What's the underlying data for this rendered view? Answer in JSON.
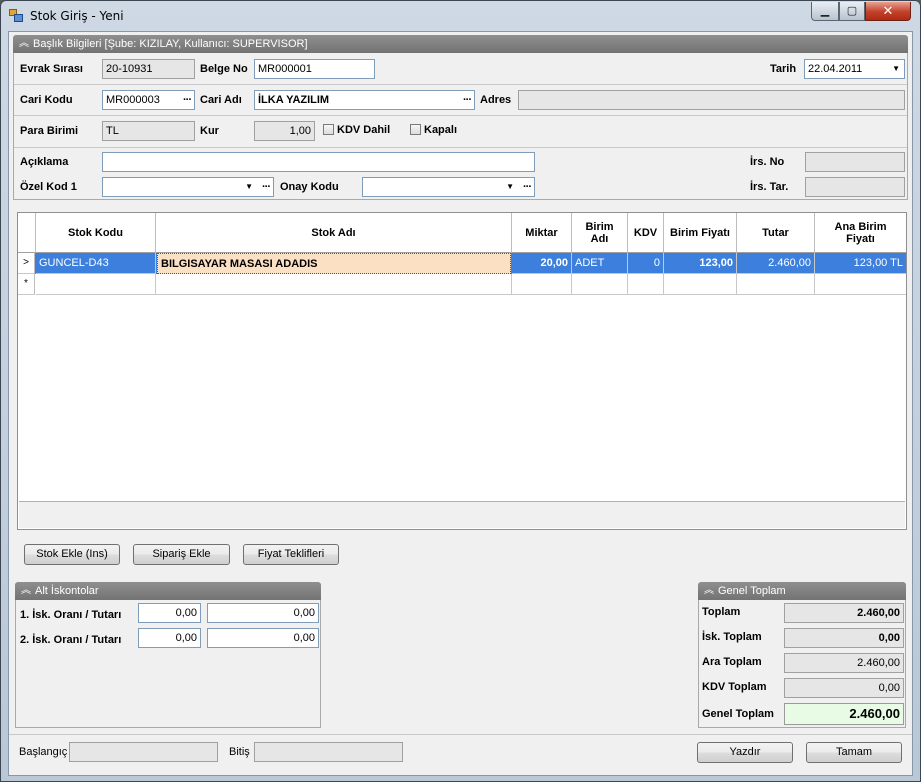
{
  "window": {
    "title": "Stok Giriş - Yeni",
    "controls": {
      "minimize": "▁",
      "maximize": "▢",
      "close": "✕"
    }
  },
  "header_group": {
    "title": "Başlık Bilgileri [Şube: KIZILAY, Kullanıcı: SUPERVISOR]",
    "evrak_sirasi_label": "Evrak Sırası",
    "evrak_sirasi": "20-10931",
    "belge_no_label": "Belge No",
    "belge_no": "MR000001",
    "tarih_label": "Tarih",
    "tarih": "22.04.2011",
    "cari_kodu_label": "Cari Kodu",
    "cari_kodu": "MR000003",
    "cari_adi_label": "Cari Adı",
    "cari_adi": "İLKA YAZILIM",
    "adres_label": "Adres",
    "adres": "",
    "para_birimi_label": "Para Birimi",
    "para_birimi": "TL",
    "kur_label": "Kur",
    "kur": "1,00",
    "kdv_dahil_label": "KDV Dahil",
    "kapali_label": "Kapalı",
    "aciklama_label": "Açıklama",
    "aciklama": "",
    "irs_no_label": "İrs. No",
    "irs_no": "",
    "ozel_kod_label": "Özel Kod 1",
    "ozel_kod": "",
    "onay_kodu_label": "Onay Kodu",
    "onay_kodu": "",
    "irs_tar_label": "İrs. Tar.",
    "irs_tar": ""
  },
  "grid": {
    "columns": {
      "stok_kodu": "Stok Kodu",
      "stok_adi": "Stok Adı",
      "miktar": "Miktar",
      "birim_adi": "Birim Adı",
      "kdv": "KDV",
      "birim_fiyati": "Birim Fiyatı",
      "tutar": "Tutar",
      "ana_birim_fiyati": "Ana Birim Fiyatı"
    },
    "rows": [
      {
        "indicator": ">",
        "stok_kodu": "GUNCEL-D43",
        "stok_adi": "BILGISAYAR MASASI ADADIS",
        "miktar": "20,00",
        "birim_adi": "ADET",
        "kdv": "0",
        "birim_fiyati": "123,00",
        "tutar": "2.460,00",
        "ana_birim_fiyati": "123,00 TL"
      }
    ],
    "new_row_indicator": "*"
  },
  "grid_buttons": {
    "stok_ekle": "Stok Ekle (Ins)",
    "siparis_ekle": "Sipariş Ekle",
    "fiyat_teklifleri": "Fiyat Teklifleri"
  },
  "alt_iskontolar": {
    "title": "Alt İskontolar",
    "isk1_label": "1. İsk. Oranı / Tutarı",
    "isk1_oran": "0,00",
    "isk1_tutar": "0,00",
    "isk2_label": "2. İsk. Oranı / Tutarı",
    "isk2_oran": "0,00",
    "isk2_tutar": "0,00"
  },
  "genel_toplam": {
    "title": "Genel Toplam",
    "toplam_label": "Toplam",
    "toplam": "2.460,00",
    "isk_toplam_label": "İsk. Toplam",
    "isk_toplam": "0,00",
    "ara_toplam_label": "Ara Toplam",
    "ara_toplam": "2.460,00",
    "kdv_toplam_label": "KDV Toplam",
    "kdv_toplam": "0,00",
    "genel_toplam_label": "Genel Toplam",
    "genel_toplam": "2.460,00"
  },
  "footer": {
    "baslangic_label": "Başlangıç",
    "baslangic": "",
    "bitis_label": "Bitiş",
    "bitis": "",
    "yazdir": "Yazdır",
    "tamam": "Tamam"
  },
  "colors": {
    "selected_row": "#3c7fdc",
    "edit_cell": "#fbe0c4",
    "total_highlight": "#e8fbe4",
    "group_header": "#808080"
  }
}
